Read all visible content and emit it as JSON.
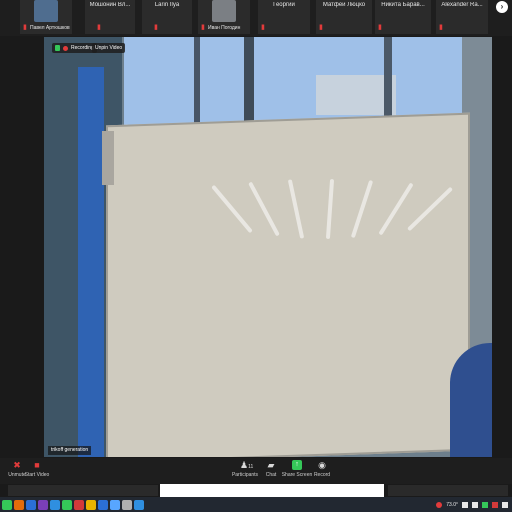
{
  "participants": [
    {
      "name": "",
      "label": "Павел Артюшков",
      "thumb": "#4f6d8f"
    },
    {
      "name": "Мошонин Вл...",
      "label": ""
    },
    {
      "name": "Larin Ilya",
      "label": ""
    },
    {
      "name": "",
      "label": "Иван Погодин",
      "thumb": "#7b7f84"
    },
    {
      "name": "Георгий",
      "label": ""
    },
    {
      "name": "Матфей Люцко",
      "label": ""
    },
    {
      "name": "Никита Барав...",
      "label": ""
    },
    {
      "name": "Alexander Ra...",
      "label": ""
    }
  ],
  "next_icon": "chevron-right-icon",
  "video": {
    "recording_label": "Recording",
    "unpin_label": "Unpin Video",
    "speaker_name": "trikoff generation"
  },
  "toolbar": {
    "unmute": "Unmute",
    "start_video": "Start Video",
    "participants": "Participants",
    "participant_count": "11",
    "chat": "Chat",
    "share_screen": "Share Screen",
    "record": "Record"
  },
  "taskbar": {
    "temperature": "73.0°",
    "apps": [
      "#e36c0a",
      "#2b6fd6",
      "#7a3fb8",
      "#2f8fe0",
      "#35c759",
      "#d33a3a",
      "#e8b400",
      "#2b6fd6",
      "#58a6ff",
      "#b0b0b0",
      "#35c759",
      "#2f8fe0"
    ]
  },
  "colors": {
    "accent_green": "#35c759",
    "muted_red": "#e23b3b"
  }
}
